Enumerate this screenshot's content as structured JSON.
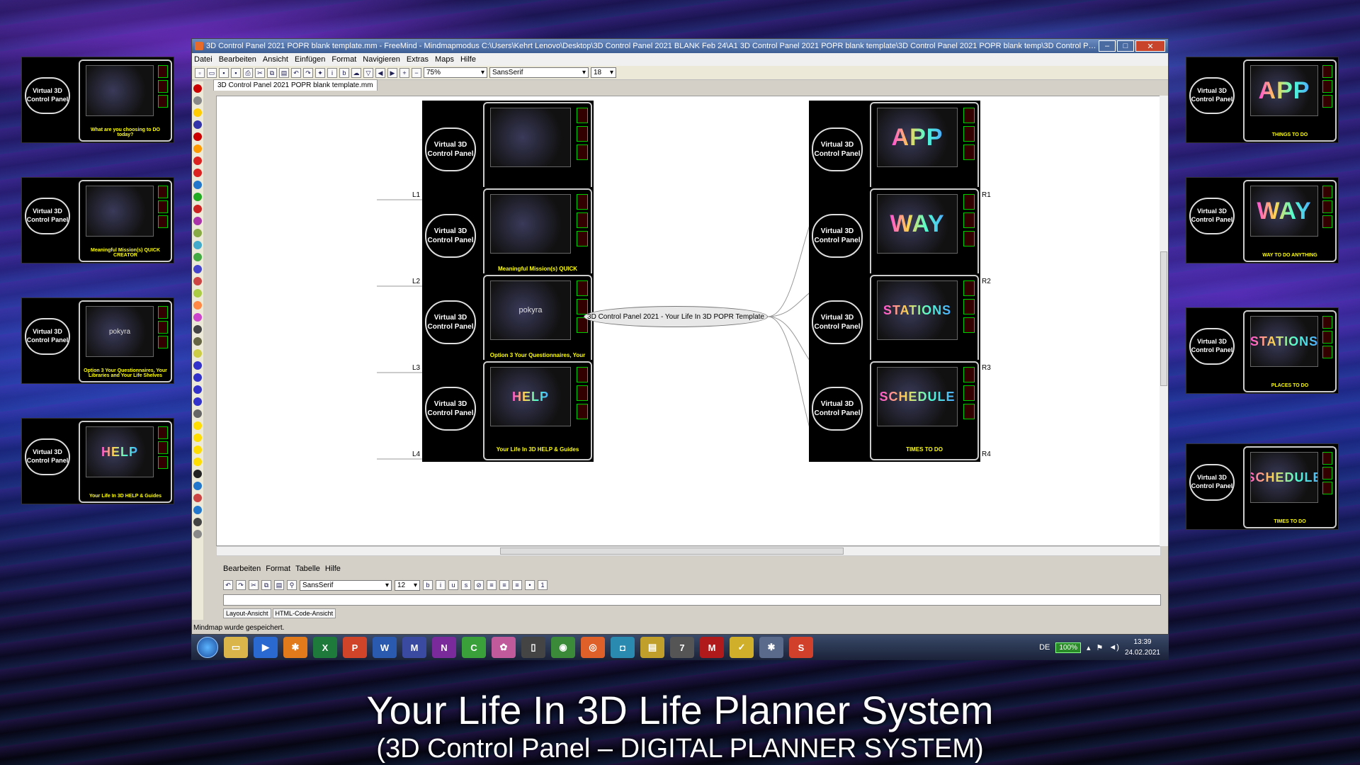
{
  "window": {
    "title": "3D Control Panel 2021 POPR blank template.mm - FreeMind - Mindmapmodus C:\\Users\\Kehrt Lenovo\\Desktop\\3D Control Panel 2021 BLANK Feb 24\\A1 3D Control Panel 2021 POPR blank template\\3D Control Panel 2021 POPR blank temp\\3D Control Panel 2021 POP...",
    "minimize": "–",
    "maximize": "□",
    "close": "✕"
  },
  "menu": [
    "Datei",
    "Bearbeiten",
    "Ansicht",
    "Einfügen",
    "Format",
    "Navigieren",
    "Extras",
    "Maps",
    "Hilfe"
  ],
  "toolbar": {
    "zoom": "75%",
    "font": "SansSerif",
    "size": "18"
  },
  "tab_label": "3D Control Panel 2021 POPR blank template.mm",
  "central_node": "3D Control Panel 2021 - Your Life In 3D POPR Template",
  "bubble_text": "Virtual 3D Control Panel",
  "left_nodes": [
    {
      "label": "L1",
      "caption": "What are you choosing to DO today?",
      "screen": ""
    },
    {
      "label": "L2",
      "caption": "Meaningful Mission(s) QUICK CREATOR",
      "screen": ""
    },
    {
      "label": "L3",
      "caption": "Option 3 Your Questionnaires, Your Libraries and Your Life Shelves",
      "screen": "pokyra"
    },
    {
      "label": "L4",
      "caption": "Your Life In 3D HELP & Guides",
      "screen": "HELP"
    }
  ],
  "right_nodes": [
    {
      "label": "R1",
      "caption": "THINGS TO DO",
      "screen": "APP"
    },
    {
      "label": "R2",
      "caption": "WAY TO DO ANYTHING",
      "screen": "WAY"
    },
    {
      "label": "R3",
      "caption": "PLACES TO DO",
      "screen": "STATIONS"
    },
    {
      "label": "R4",
      "caption": "TIMES TO DO",
      "screen": "SCHEDULE"
    }
  ],
  "editor": {
    "menu": [
      "Bearbeiten",
      "Format",
      "Tabelle",
      "Hilfe"
    ],
    "font": "SansSerif",
    "size": "12",
    "tabs": [
      "Layout-Ansicht",
      "HTML-Code-Ansicht"
    ]
  },
  "status": "Mindmap wurde gespeichert.",
  "taskbar": {
    "apps": [
      "explorer",
      "media",
      "freemind",
      "excel",
      "powerpoint",
      "word",
      "app",
      "onenote",
      "app2",
      "app3",
      "app4",
      "chrome",
      "firefox",
      "camera",
      "files",
      "app7",
      "mcafee",
      "norton",
      "freemind2",
      "app-s"
    ],
    "language": "DE",
    "battery": "100%",
    "time": "13:39",
    "date": "24.02.2021"
  },
  "caption": {
    "main": "Your Life In 3D Life Planner System",
    "sub": "(3D Control Panel – DIGITAL PLANNER SYSTEM)"
  }
}
